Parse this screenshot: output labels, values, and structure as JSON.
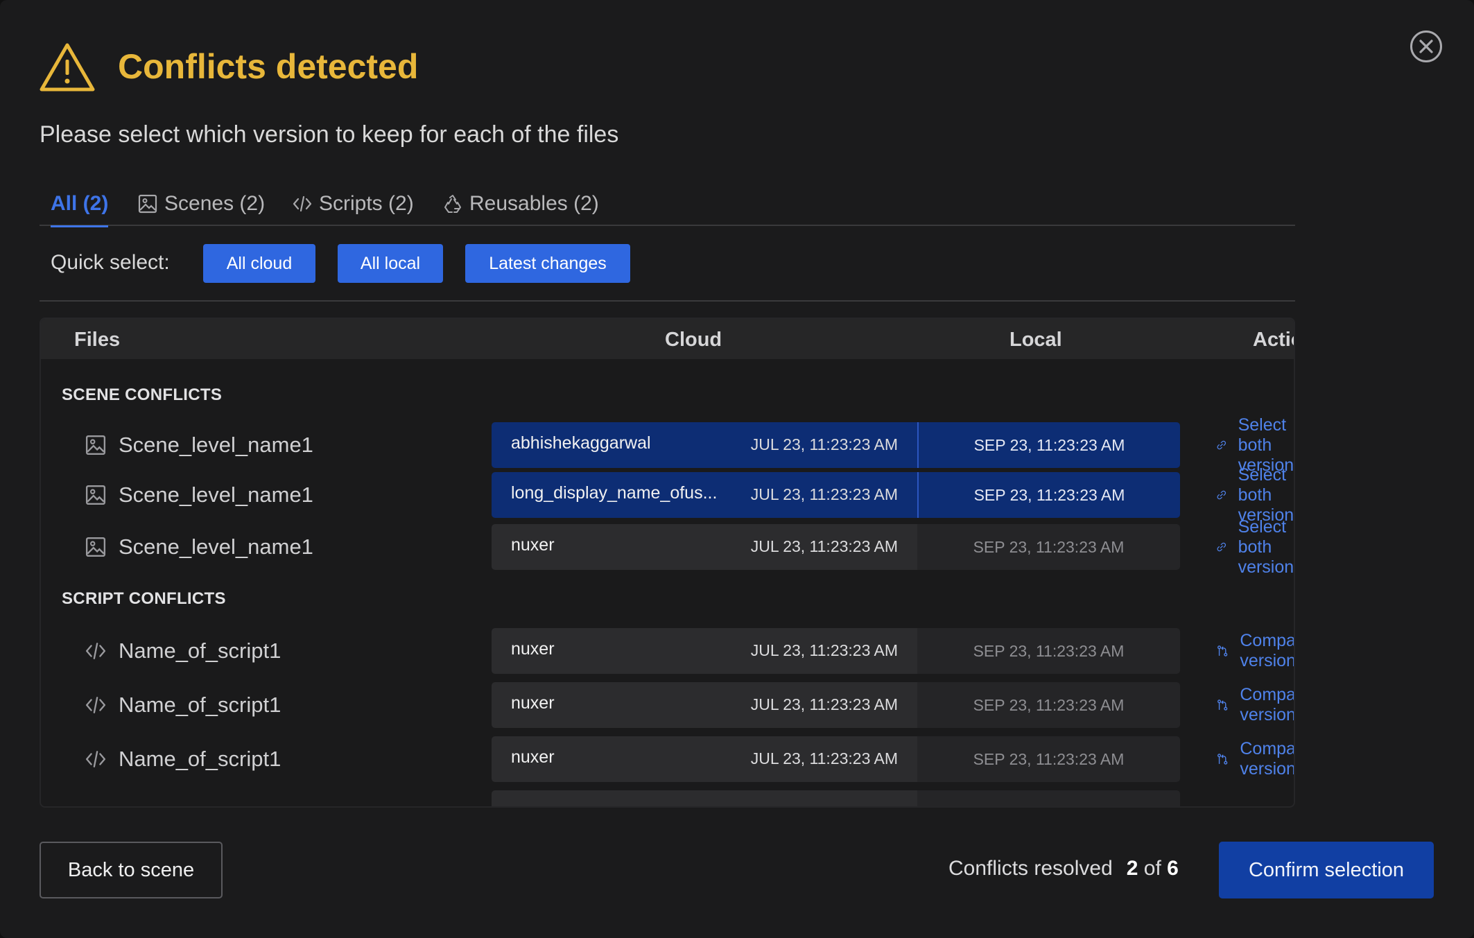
{
  "dialog": {
    "title": "Conflicts detected",
    "subtitle": "Please select which version to keep for each of the files"
  },
  "tabs": [
    {
      "label": "All (2)",
      "icon": "",
      "active": true
    },
    {
      "label": "Scenes (2)",
      "icon": "image-icon",
      "active": false
    },
    {
      "label": "Scripts (2)",
      "icon": "code-icon",
      "active": false
    },
    {
      "label": "Reusables (2)",
      "icon": "recycle-icon",
      "active": false
    }
  ],
  "quick_select": {
    "label": "Quick select:",
    "buttons": [
      "All cloud",
      "All local",
      "Latest changes"
    ]
  },
  "table": {
    "headers": {
      "files": "Files",
      "cloud": "Cloud",
      "local": "Local",
      "actions": "Actions"
    },
    "sections": [
      {
        "label": "SCENE CONFLICTS",
        "rows": [
          {
            "file": "Scene_level_name1",
            "icon": "image-icon",
            "user": "abhishekaggarwal",
            "cloud_date": "JUL 23, 11:23:23 AM",
            "local_date": "SEP 23, 11:23:23 AM",
            "selected": true,
            "action": "Select both versions",
            "action_icon": "link-icon"
          },
          {
            "file": "Scene_level_name1",
            "icon": "image-icon",
            "user": "long_display_name_ofus...",
            "cloud_date": "JUL 23, 11:23:23 AM",
            "local_date": "SEP 23, 11:23:23 AM",
            "selected": true,
            "action": "Select both versions",
            "action_icon": "link-icon"
          },
          {
            "file": "Scene_level_name1",
            "icon": "image-icon",
            "user": "nuxer",
            "cloud_date": "JUL 23, 11:23:23 AM",
            "local_date": "SEP 23, 11:23:23 AM",
            "selected": false,
            "action": "Select both versions",
            "action_icon": "link-icon"
          }
        ]
      },
      {
        "label": "SCRIPT CONFLICTS",
        "rows": [
          {
            "file": "Name_of_script1",
            "icon": "code-icon",
            "user": "nuxer",
            "cloud_date": "JUL 23, 11:23:23 AM",
            "local_date": "SEP 23, 11:23:23 AM",
            "selected": false,
            "action": "Compare versions",
            "action_icon": "compare-icon"
          },
          {
            "file": "Name_of_script1",
            "icon": "code-icon",
            "user": "nuxer",
            "cloud_date": "JUL 23, 11:23:23 AM",
            "local_date": "SEP 23, 11:23:23 AM",
            "selected": false,
            "action": "Compare versions",
            "action_icon": "compare-icon"
          },
          {
            "file": "Name_of_script1",
            "icon": "code-icon",
            "user": "nuxer",
            "cloud_date": "JUL 23, 11:23:23 AM",
            "local_date": "SEP 23, 11:23:23 AM",
            "selected": false,
            "action": "Compare versions",
            "action_icon": "compare-icon"
          }
        ]
      }
    ]
  },
  "footer": {
    "back_label": "Back to scene",
    "resolved_label": "Conflicts resolved",
    "resolved_count": "2",
    "resolved_of": "of",
    "resolved_total": "6",
    "confirm_label": "Confirm selection"
  },
  "colors": {
    "accent": "#2f67e0",
    "warning": "#e8b73a",
    "selected_row": "#0d2d74",
    "link": "#4f82ea"
  }
}
